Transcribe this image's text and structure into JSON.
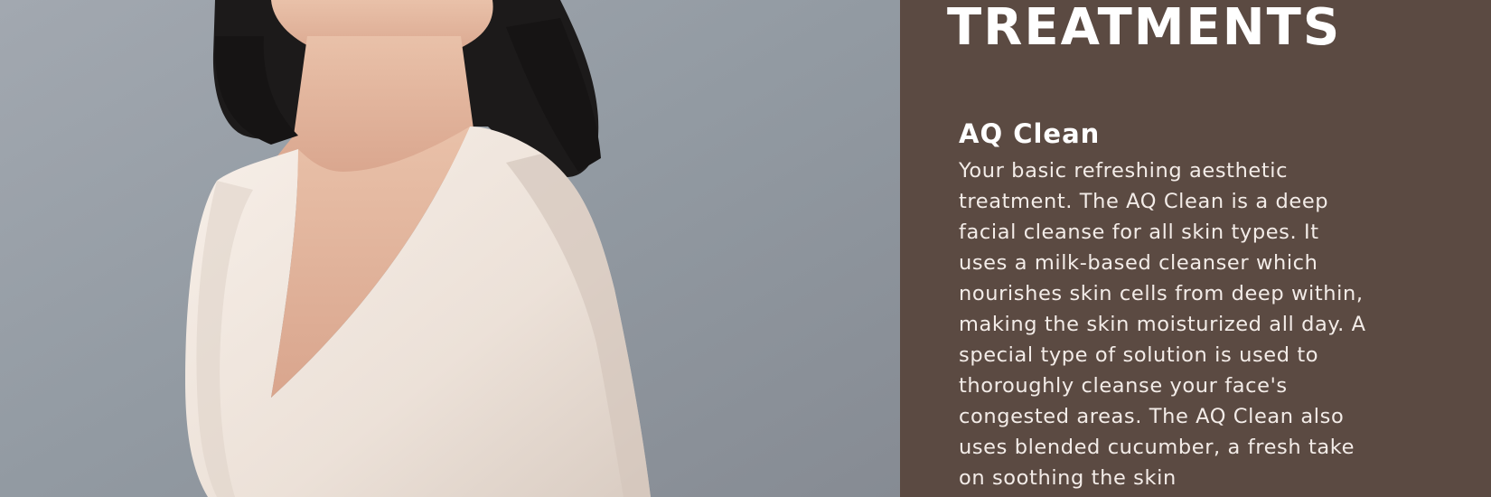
{
  "colors": {
    "panel_background": "#5b4a42",
    "photo_background": "#8e949c",
    "text": "#ffffff"
  },
  "photo": {
    "description_icon": "portrait-photo"
  },
  "section": {
    "title": "TREATMENTS"
  },
  "treatment": {
    "name": "AQ Clean",
    "description": "Your basic refreshing aesthetic treatment. The AQ Clean is a deep facial cleanse for all skin types. It uses a milk-based cleanser which nourishes skin cells from deep within, making the skin moisturized all day. A special type of solution is used to thoroughly cleanse your face's congested areas. The AQ Clean also uses blended cucumber, a fresh take on soothing the skin"
  }
}
